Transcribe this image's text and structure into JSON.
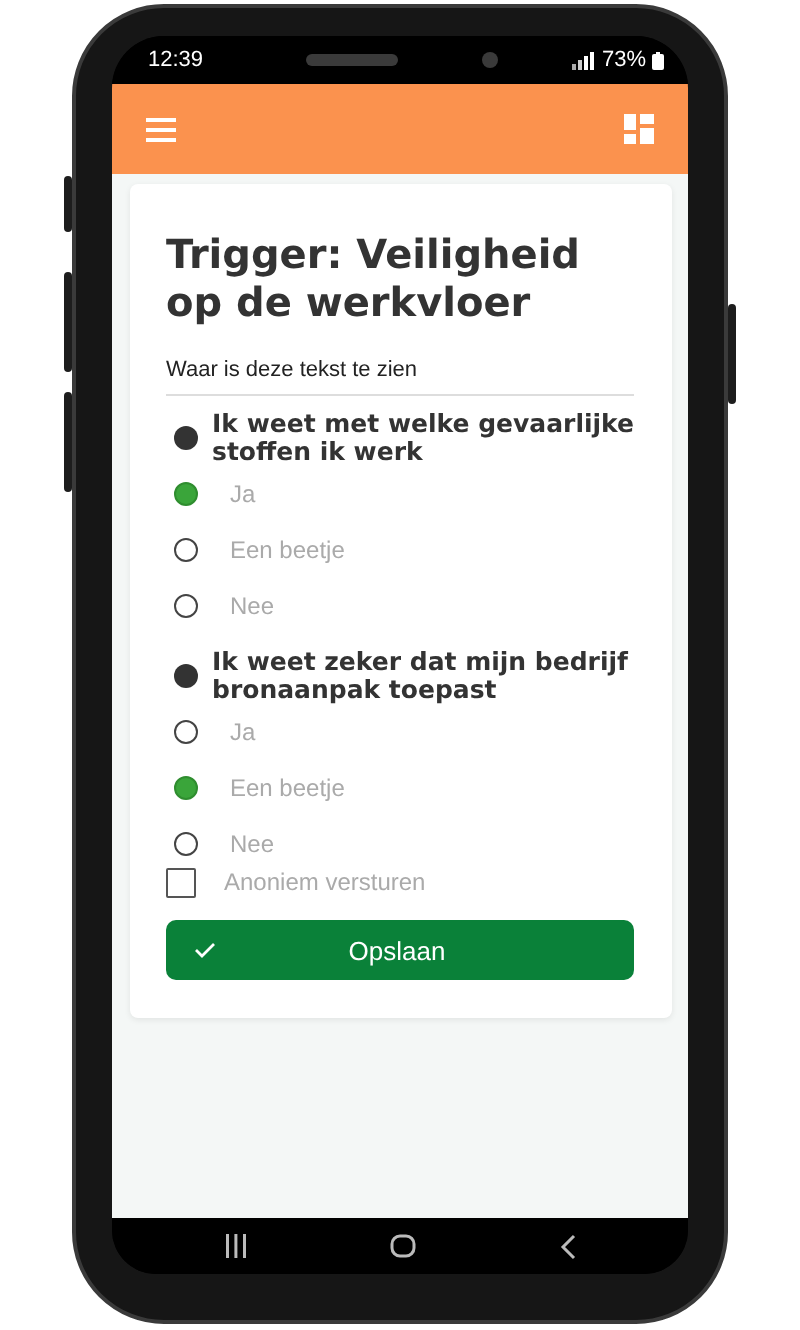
{
  "status_bar": {
    "time": "12:39",
    "battery": "73%"
  },
  "title": "Trigger: Veiligheid op de werkvloer",
  "subtitle": "Waar is deze tekst te zien",
  "questions": [
    {
      "text": "Ik weet met welke gevaarlijke stoffen ik werk",
      "options": [
        {
          "label": "Ja",
          "selected": true
        },
        {
          "label": "Een beetje",
          "selected": false
        },
        {
          "label": "Nee",
          "selected": false
        }
      ]
    },
    {
      "text": "Ik weet zeker dat mijn bedrijf bronaanpak toepast",
      "options": [
        {
          "label": "Ja",
          "selected": false
        },
        {
          "label": "Een beetje",
          "selected": true
        },
        {
          "label": "Nee",
          "selected": false
        }
      ]
    }
  ],
  "anonymous": {
    "label": "Anoniem versturen",
    "checked": false
  },
  "save_button": {
    "label": "Opslaan"
  }
}
